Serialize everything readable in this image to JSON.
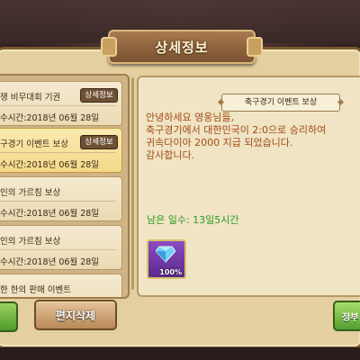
{
  "window": {
    "title": "상세정보"
  },
  "mail_list": {
    "badge_label": "상세정보",
    "items": [
      {
        "title": "쟁 비무대회 기권",
        "date": "수시간:2018년 06월 28일",
        "selected": false,
        "has_badge": true
      },
      {
        "title": "구경기 이벤트 보상",
        "date": "수시간:2018년 06월 28일",
        "selected": true,
        "has_badge": true
      },
      {
        "title": "인의 가르침 보상",
        "date": "수시간:2018년 06월 28일",
        "selected": false,
        "has_badge": false
      },
      {
        "title": "인의 가르침 보상",
        "date": "수시간:2018년 06월 28일",
        "selected": false,
        "has_badge": false
      },
      {
        "title": "한 한의 판매 이벤트",
        "date": "",
        "selected": false,
        "has_badge": false
      }
    ]
  },
  "detail": {
    "subtitle": "축구경기 이벤트 보상",
    "body_lines": [
      "안녕하세요 영웅님들,",
      "축구경기에서 대한민국이 2:0으로 승리하여",
      "귀속다이아 2000 지급 되었습니다.",
      "감사합니다."
    ],
    "remaining": "남은 일수: 13일5시간",
    "reward": {
      "icon": "diamond-icon",
      "quantity": "100%"
    }
  },
  "buttons": {
    "delete": "편지삭제",
    "receive": "정부"
  },
  "colors": {
    "body_text": "#a24a16",
    "remaining_text": "#2f9a25"
  }
}
